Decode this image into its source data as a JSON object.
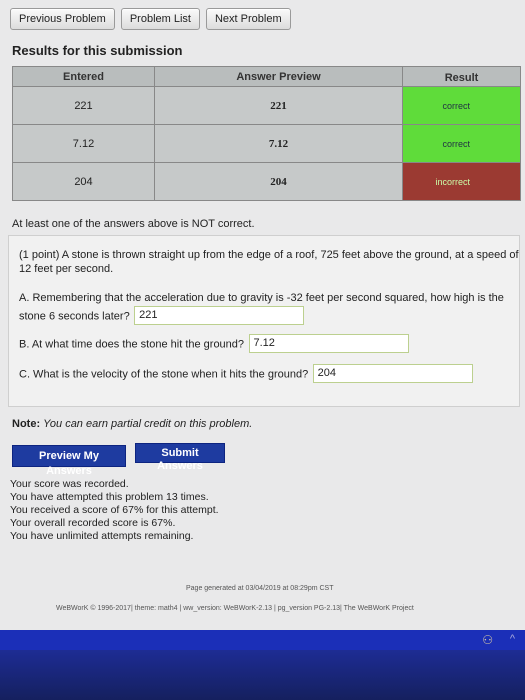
{
  "nav": {
    "previous": "Previous Problem",
    "list": "Problem List",
    "next": "Next Problem"
  },
  "results": {
    "title": "Results for this submission",
    "headers": {
      "entered": "Entered",
      "preview": "Answer Preview",
      "result": "Result"
    },
    "rows": [
      {
        "entered": "221",
        "preview": "221",
        "result": "correct",
        "status": "correct"
      },
      {
        "entered": "7.12",
        "preview": "7.12",
        "result": "correct",
        "status": "correct"
      },
      {
        "entered": "204",
        "preview": "204",
        "result": "incorrect",
        "status": "incorrect"
      }
    ],
    "warning": "At least one of the answers above is NOT correct."
  },
  "problem": {
    "statement": "(1 point) A stone is thrown straight up from the edge of a roof, 725 feet above the ground, at a speed of 12 feet per second.",
    "partA": {
      "question": "A. Remembering that the acceleration due to gravity is -32 feet per second squared, how high is the stone 6 seconds later?",
      "answer": "221"
    },
    "partB": {
      "question": "B. At what time does the stone hit the ground?",
      "answer": "7.12"
    },
    "partC": {
      "question": "C. What is the velocity of the stone when it hits the ground?",
      "answer": "204"
    }
  },
  "note": {
    "label": "Note:",
    "text": "You can earn partial credit on this problem."
  },
  "buttons": {
    "preview": "Preview My Answers",
    "submit": "Submit Answers"
  },
  "score": {
    "line1": "Your score was recorded.",
    "line2": "You have attempted this problem 13 times.",
    "line3": "You received a score of 67% for this attempt.",
    "line4": "Your overall recorded score is 67%.",
    "line5": "You have unlimited attempts remaining."
  },
  "footer": {
    "generated": "Page generated at 03/04/2019 at 08:29pm CST",
    "credits": "WeBWorK © 1996-2017| theme: math4 | ww_version: WeBWorK-2.13 | pg_version PG-2.13| The WeBWorK Project"
  },
  "colors": {
    "correct": "#5fdc3a",
    "incorrect": "#9b3a32",
    "button": "#1e3ba0"
  },
  "icons": {
    "left": "people-icon",
    "right": "chevron-up-icon"
  }
}
